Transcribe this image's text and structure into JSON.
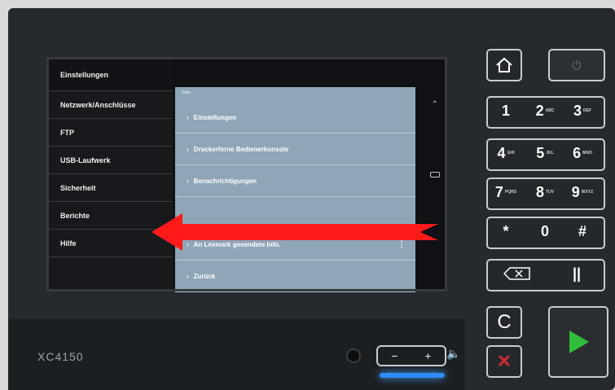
{
  "device": {
    "model": "XC4150"
  },
  "screen": {
    "title": "Einstellungen",
    "menu": [
      "Netzwerk/Anschlüsse",
      "FTP",
      "USB-Laufwerk",
      "Sicherheit",
      "Berichte",
      "Hilfe"
    ],
    "panel": {
      "header": "Seite",
      "rows": [
        "Einstellungen",
        "Druckerferne Bedienerkonsole",
        "Benachrichtigungen",
        "An Lexmark gesendete Info.",
        "Zurück"
      ]
    }
  },
  "keypad": {
    "home": "home-icon",
    "power": "power-icon",
    "digits": [
      {
        "d": "1",
        "s": ""
      },
      {
        "d": "2",
        "s": "ABC"
      },
      {
        "d": "3",
        "s": "DEF"
      },
      {
        "d": "4",
        "s": "GHI"
      },
      {
        "d": "5",
        "s": "JKL"
      },
      {
        "d": "6",
        "s": "MNO"
      },
      {
        "d": "7",
        "s": "PQRS"
      },
      {
        "d": "8",
        "s": "TUV"
      },
      {
        "d": "9",
        "s": "WXYZ"
      }
    ],
    "star": "*",
    "zero": "0",
    "hash": "#",
    "pause": "||",
    "clear": "C"
  },
  "volume": {
    "minus": "−",
    "plus": "+"
  },
  "colors": {
    "arrow": "#ff1a1a",
    "start": "#2fbe3a",
    "stop": "#d22b2b",
    "led": "#2e8cff"
  }
}
